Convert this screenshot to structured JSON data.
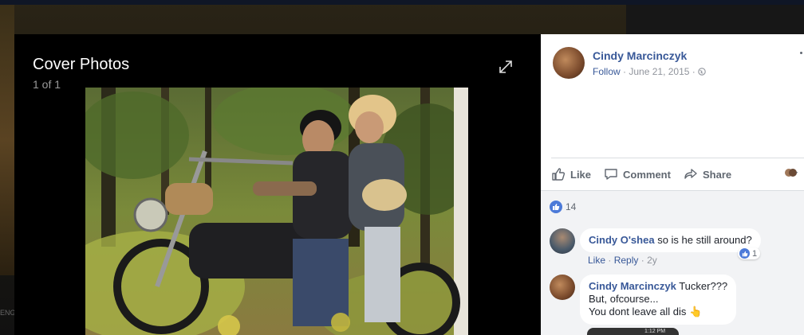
{
  "background": {
    "left_fragment_text": "ENG"
  },
  "lightbox": {
    "title": "Cover Photos",
    "counter": "1 of 1",
    "expand_icon": "expand-icon",
    "photo_alt": "cover-photo"
  },
  "post": {
    "author": "Cindy Marcinczyk",
    "follow": "Follow",
    "date": "June 21, 2015",
    "privacy_icon": "globe-icon",
    "separator": "·"
  },
  "actions": {
    "like": "Like",
    "comment": "Comment",
    "share": "Share"
  },
  "reactions": {
    "count": "14"
  },
  "comments": [
    {
      "author": "Cindy O'shea",
      "text": "so is he still around?",
      "like_link": "Like",
      "reply_link": "Reply",
      "age": "2y",
      "reaction_count": "1"
    },
    {
      "author": "Cindy Marcinczyk",
      "text_line1": "Tucker???",
      "text_line2": "But, ofcourse...",
      "text_line3": "You dont leave all dis",
      "emoji": "👆",
      "attachment_time": "1:12 PM"
    }
  ],
  "colors": {
    "link_blue": "#385898",
    "like_blue": "#4c7ad8",
    "panel_bg": "#f2f3f5"
  }
}
